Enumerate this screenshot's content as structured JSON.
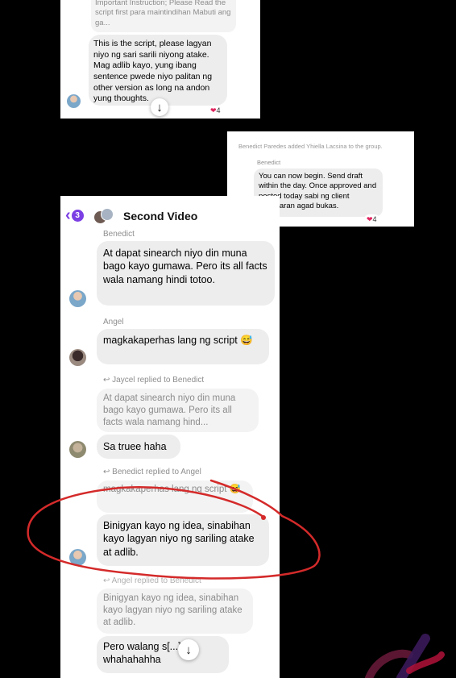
{
  "card1": {
    "partial_text": "Important Instruction; Please Read the script first para maintindihan Mabuti ang ga...",
    "message": "This is the script, please lagyan niyo ng sari sarili niyong atake. Mag adlib kayo, yung ibang sentence pwede niyo palitan ng other version as long na andon yung thoughts.",
    "reaction_count": "4"
  },
  "card2": {
    "system_notice": "Benedict Paredes added Yhiella Lacsina to the group.",
    "sender": "Benedict",
    "message": "You can now begin. Send draft within the day. Once approved and posted today sabi ng client babayaran agad bukas.",
    "reaction_count": "4"
  },
  "chat": {
    "back_badge": "3",
    "title": "Second Video",
    "messages": [
      {
        "sender": "Benedict",
        "text": "At dapat sinearch niyo din muna bago kayo gumawa. Pero its all facts wala namang hindi totoo."
      },
      {
        "sender": "Angel",
        "text": "magkakaperhas lang ng script 😅"
      },
      {
        "reply_label": "Jaycel replied to Benedict",
        "quote": "At dapat sinearch niyo din muna bago kayo gumawa. Pero its all facts wala namang hind...",
        "text": "Sa truee haha"
      },
      {
        "reply_label": "Benedict replied to Angel",
        "quote": "magkakaperhas lang ng script 😅",
        "text": "Binigyan kayo ng idea, sinabihan kayo lagyan niyo ng sariling atake at adlib."
      },
      {
        "reply_label": "Angel replied to Benedict",
        "quote": "Binigyan kayo ng idea, sinabihan kayo lagyan niyo ng sariling atake at adlib.",
        "text": "Pero walang s[...]od whahahahha"
      }
    ]
  },
  "colors": {
    "accent": "#7b3fe4",
    "annotation": "#d42a2a",
    "heart": "#e0245e",
    "bubble": "#ededed"
  },
  "icons": [
    "back-chevron-icon",
    "group-avatar-icon",
    "heart-icon",
    "arrow-down-icon",
    "watermark-logo-icon"
  ]
}
